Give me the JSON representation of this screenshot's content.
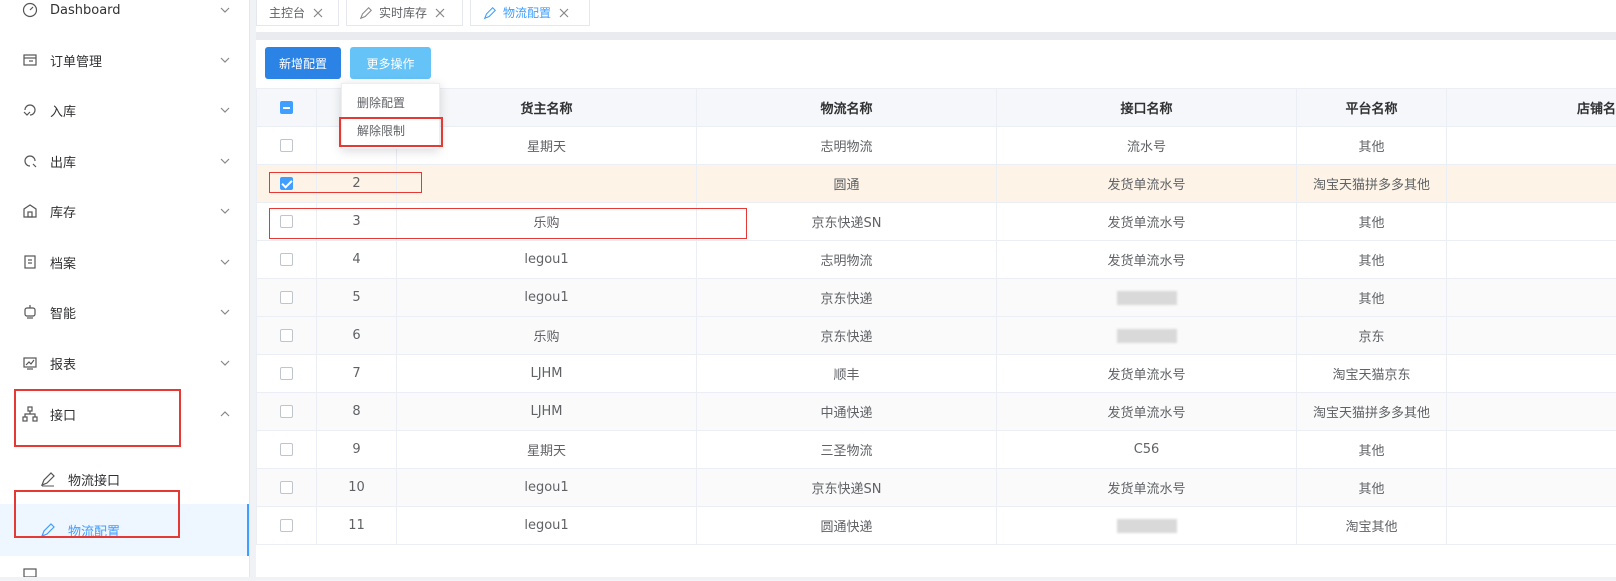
{
  "sidebar": {
    "items": [
      {
        "label": "Dashboard",
        "icon": "dashboard-icon"
      },
      {
        "label": "订单管理",
        "icon": "order-icon"
      },
      {
        "label": "入库",
        "icon": "inbound-icon"
      },
      {
        "label": "出库",
        "icon": "outbound-icon"
      },
      {
        "label": "库存",
        "icon": "inventory-icon"
      },
      {
        "label": "档案",
        "icon": "archive-icon"
      },
      {
        "label": "智能",
        "icon": "smart-icon"
      },
      {
        "label": "报表",
        "icon": "report-icon"
      },
      {
        "label": "接口",
        "icon": "api-icon"
      }
    ],
    "sub_items": [
      {
        "label": "物流接口",
        "icon": "pen-icon"
      },
      {
        "label": "物流配置",
        "icon": "pen-icon"
      }
    ]
  },
  "tabs": [
    {
      "label": "主控台"
    },
    {
      "label": "实时库存"
    },
    {
      "label": "物流配置"
    }
  ],
  "toolbar": {
    "add_label": "新增配置",
    "more_label": "更多操作"
  },
  "dropdown": {
    "items": [
      "删除配置",
      "解除限制"
    ]
  },
  "table": {
    "headers": [
      "",
      "",
      "货主名称",
      "物流名称",
      "接口名称",
      "平台名称",
      "店铺名"
    ],
    "rows": [
      {
        "no": "",
        "owner": "星期天",
        "logistics": "志明物流",
        "api": "流水号",
        "platform": "其他"
      },
      {
        "no": "2",
        "owner": "",
        "logistics": "圆通",
        "api": "发货单流水号",
        "platform": "淘宝天猫拼多多其他"
      },
      {
        "no": "3",
        "owner": "乐购",
        "logistics": "京东快递SN",
        "api": "发货单流水号",
        "platform": "其他"
      },
      {
        "no": "4",
        "owner": "legou1",
        "logistics": "志明物流",
        "api": "发货单流水号",
        "platform": "其他"
      },
      {
        "no": "5",
        "owner": "legou1",
        "logistics": "京东快递",
        "api": "",
        "platform": "其他"
      },
      {
        "no": "6",
        "owner": "乐购",
        "logistics": "京东快递",
        "api": "",
        "platform": "京东"
      },
      {
        "no": "7",
        "owner": "LJHM",
        "logistics": "顺丰",
        "api": "发货单流水号",
        "platform": "淘宝天猫京东"
      },
      {
        "no": "8",
        "owner": "LJHM",
        "logistics": "中通快递",
        "api": "发货单流水号",
        "platform": "淘宝天猫拼多多其他"
      },
      {
        "no": "9",
        "owner": "星期天",
        "logistics": "三圣物流",
        "api": "C56",
        "platform": "其他"
      },
      {
        "no": "10",
        "owner": "legou1",
        "logistics": "京东快递SN",
        "api": "发货单流水号",
        "platform": "其他"
      },
      {
        "no": "11",
        "owner": "legou1",
        "logistics": "圆通快递",
        "api": "",
        "platform": "淘宝其他"
      }
    ]
  },
  "colors": {
    "primary": "#2b83e6",
    "more_button": "#66c3f7",
    "active": "#409eff",
    "selected_row": "#fdf4e7",
    "annotation_red": "#e53935"
  }
}
